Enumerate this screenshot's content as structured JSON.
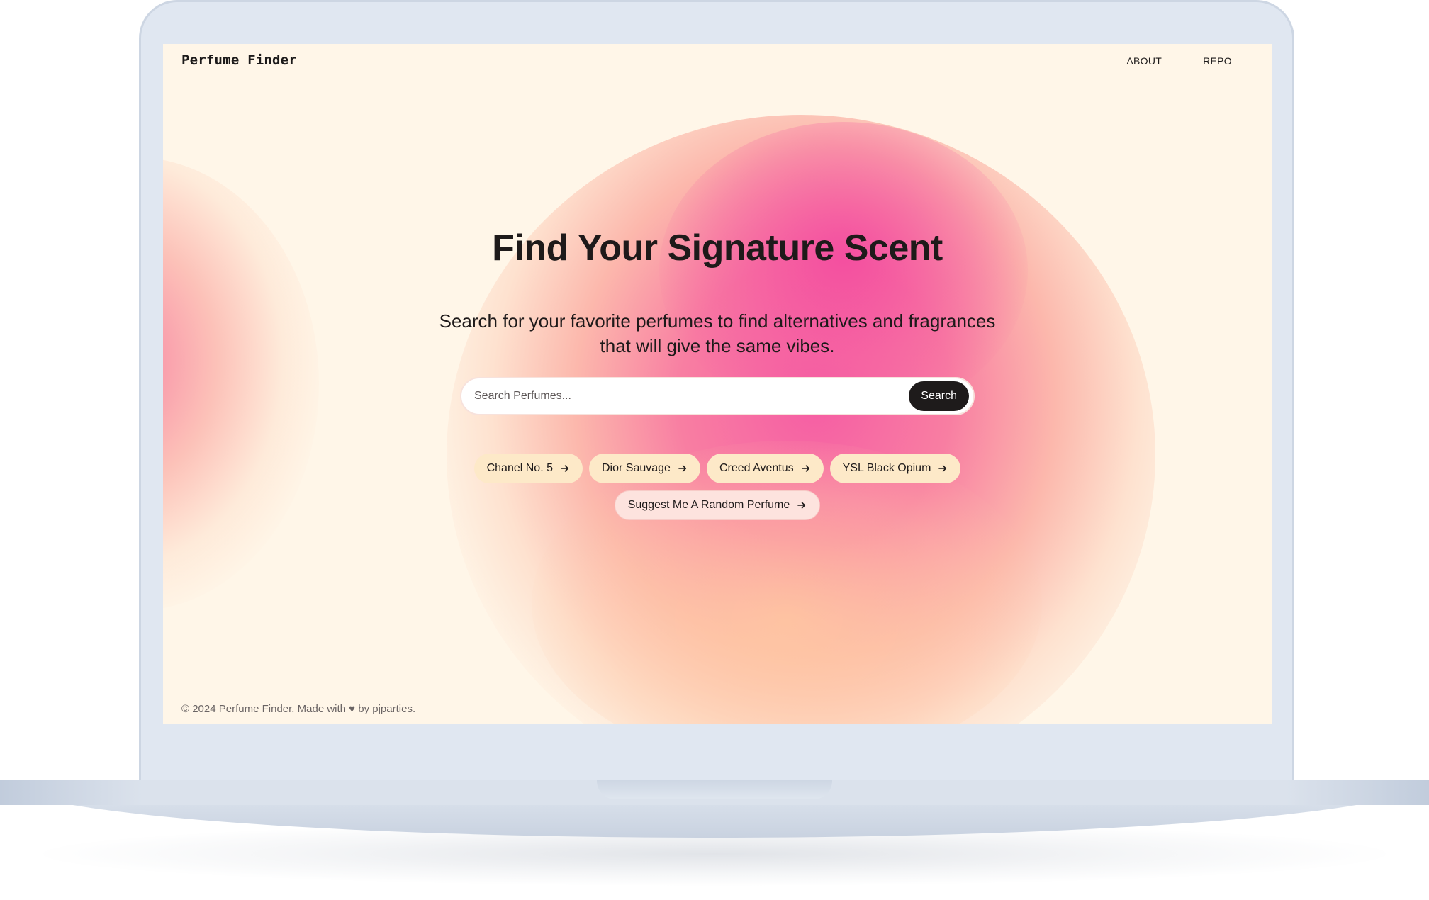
{
  "header": {
    "brand": "Perfume Finder",
    "nav": [
      {
        "label": "ABOUT"
      },
      {
        "label": "REPO"
      }
    ]
  },
  "hero": {
    "title": "Find Your Signature Scent",
    "subtitle": "Search for your favorite perfumes to find alternatives and fragrances that will give the same vibes."
  },
  "search": {
    "placeholder": "Search Perfumes...",
    "value": "",
    "button_label": "Search"
  },
  "suggestions": [
    {
      "label": "Chanel No. 5"
    },
    {
      "label": "Dior Sauvage"
    },
    {
      "label": "Creed Aventus"
    },
    {
      "label": "YSL Black Opium"
    }
  ],
  "random": {
    "label": "Suggest Me A Random Perfume"
  },
  "footer": {
    "text": "© 2024 Perfume Finder. Made with ♥ by pjparties."
  },
  "icons": {
    "chip_arrow": "arrow-right-icon"
  },
  "colors": {
    "text": "#1e1a1a",
    "search_button_bg": "#1e1b1b",
    "chip_bg": "#fde9c8",
    "random_chip_bg": "#fde3de",
    "page_bg": "#fff6e8",
    "gradient_pink": "#f555a0",
    "gradient_peach": "#ffcda0"
  }
}
